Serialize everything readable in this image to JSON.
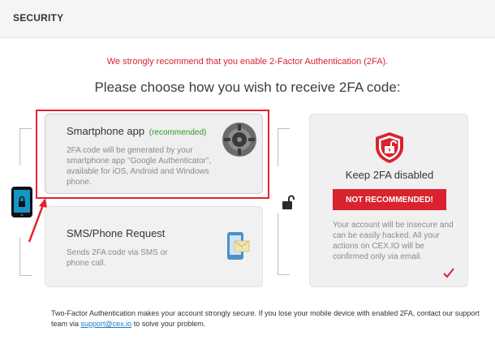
{
  "header": {
    "title": "SECURITY"
  },
  "recommendation": "We strongly recommend that you enable 2-Factor Authentication (2FA).",
  "headline": "Please choose how you wish to receive 2FA code:",
  "options": {
    "smartphone": {
      "title": "Smartphone app",
      "badge": "(recommended)",
      "description": "2FA code will be generated by your smartphone app \"Google Authenticator\", available for iOS, Android and Windows phone."
    },
    "sms": {
      "title": "SMS/Phone Request",
      "description": "Sends 2FA code via SMS or phone call."
    },
    "disabled": {
      "title": "Keep 2FA disabled",
      "button_label": "NOT RECOMMENDED!",
      "description": "Your account will be insecure and can be easily hacked. All your actions on CEX.IO will be confirmed only via email."
    }
  },
  "footer": {
    "text_before": "Two-Factor Authentication makes your account strongly secure. If you lose your mobile device with enabled 2FA, contact our support team via ",
    "email": "support@cex.io",
    "text_after": " to solve your problem."
  },
  "colors": {
    "accent_red": "#d9232e",
    "recommended_green": "#2d9b2d",
    "link_blue": "#1a7cc9",
    "phone_blue": "#1596c8"
  },
  "icons": [
    "google-authenticator-icon",
    "sms-phone-icon",
    "shield-lock-icon",
    "checkmark-icon",
    "phone-lock-icon",
    "unlock-icon",
    "arrow-icon"
  ]
}
